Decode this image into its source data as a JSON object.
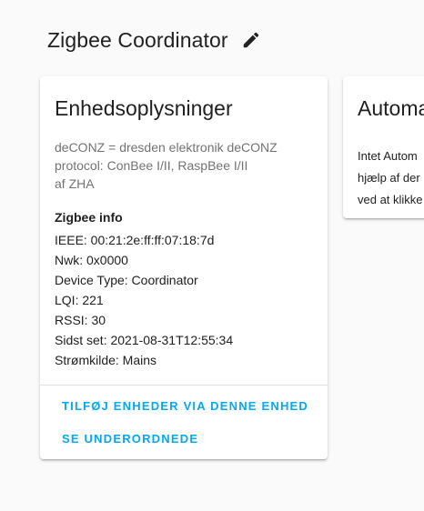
{
  "header": {
    "title": "Zigbee Coordinator",
    "edit_icon": "pencil-icon"
  },
  "device_card": {
    "title": "Enhedsoplysninger",
    "description": {
      "line1": "deCONZ = dresden elektronik deCONZ",
      "line2": "protocol: ConBee I/II, RaspBee I/II",
      "line3": "af ZHA"
    },
    "zigbee_info": {
      "heading": "Zigbee info",
      "rows": [
        "IEEE: 00:21:2e:ff:ff:07:18:7d",
        "Nwk: 0x0000",
        "Device Type: Coordinator",
        "LQI: 221",
        "RSSI: 30",
        "Sidst set: 2021-08-31T12:55:34",
        "Strømkilde: Mains"
      ]
    },
    "actions": {
      "add_devices": "TILFØJ ENHEDER VIA DENNE ENHED",
      "show_children": "SE UNDERORDNEDE"
    }
  },
  "automation_card": {
    "title": "Automa",
    "lines": [
      "Intet Autom",
      "hjælp af der",
      "ved at klikke"
    ]
  },
  "colors": {
    "background": "#fafafa",
    "card": "#ffffff",
    "accent": "#03a9f4",
    "secondary_text": "#737373",
    "primary_text": "#212121"
  }
}
